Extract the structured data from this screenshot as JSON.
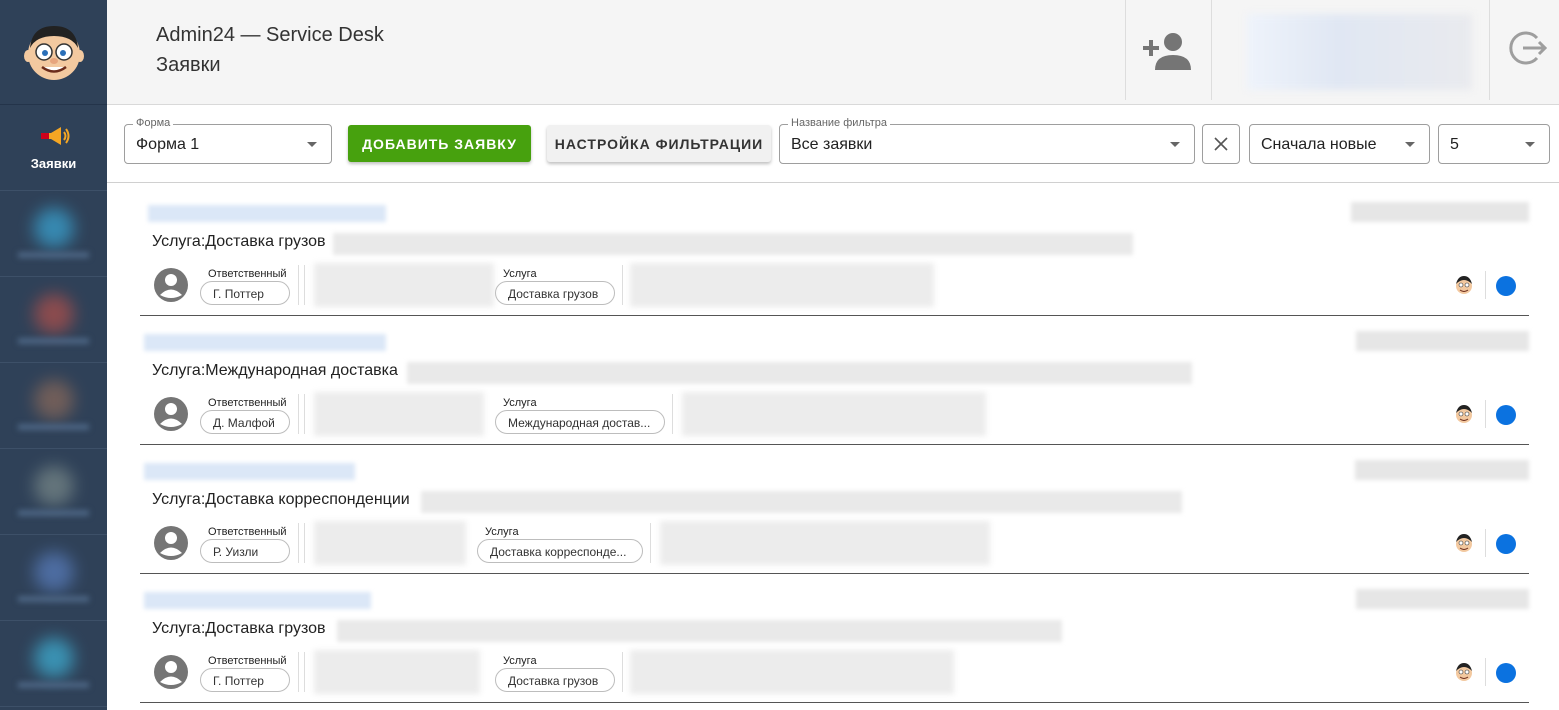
{
  "header": {
    "app_title": "Admin24 — Service Desk",
    "page_title": "Заявки"
  },
  "sidebar": {
    "active_item": {
      "label": "Заявки",
      "icon": "megaphone-icon"
    }
  },
  "toolbar": {
    "form": {
      "label": "Форма",
      "value": "Форма 1"
    },
    "add_button": "ДОБАВИТЬ ЗАЯВКУ",
    "filter_settings_button": "НАСТРОЙКА ФИЛЬТРАЦИИ",
    "filter_name": {
      "label": "Название фильтра",
      "value": "Все заявки"
    },
    "sort": {
      "value": "Сначала новые"
    },
    "page_size": {
      "value": "5"
    }
  },
  "tickets": [
    {
      "subject": "Услуга:Доставка грузов",
      "responsible_label": "Ответственный",
      "responsible": "Г. Поттер",
      "service_label": "Услуга",
      "service": "Доставка грузов",
      "status_color": "#0b72e0"
    },
    {
      "subject": "Услуга:Международная доставка",
      "responsible_label": "Ответственный",
      "responsible": "Д. Малфой",
      "service_label": "Услуга",
      "service": "Международная достав...",
      "status_color": "#0b72e0"
    },
    {
      "subject": "Услуга:Доставка корреспонденции",
      "responsible_label": "Ответственный",
      "responsible": "Р. Уизли",
      "service_label": "Услуга",
      "service": "Доставка корреспонде...",
      "status_color": "#0b72e0"
    },
    {
      "subject": "Услуга:Доставка грузов",
      "responsible_label": "Ответственный",
      "responsible": "Г. Поттер",
      "service_label": "Услуга",
      "service": "Доставка грузов",
      "status_color": "#0b72e0"
    }
  ]
}
